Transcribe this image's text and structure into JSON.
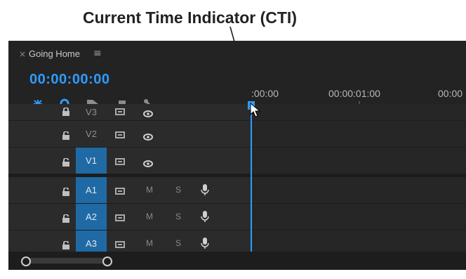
{
  "callout": {
    "label": "Current Time Indicator (CTI)"
  },
  "panel": {
    "close_glyph": "×",
    "sequence_name": "Going Home",
    "menu_glyph": "≡",
    "timecode": "00:00:00:00",
    "accent": "#2f9bff"
  },
  "toolbar": {
    "icons": [
      "insert-nest-icon",
      "snap-magnet-icon",
      "linked-selection-icon",
      "add-marker-icon",
      "timeline-settings-wrench-icon"
    ]
  },
  "ruler": {
    "labels": [
      ":00:00",
      "00:00:01:00",
      "00:00"
    ]
  },
  "tracks": [
    {
      "lock": "lock-icon",
      "target": "V3",
      "type": "video",
      "active": false
    },
    {
      "lock": "lock-icon",
      "target": "V2",
      "type": "video",
      "active": false
    },
    {
      "lock": "lock-icon",
      "target": "V1",
      "type": "video",
      "active": true
    },
    {
      "lock": "lock-icon",
      "target": "A1",
      "type": "audio",
      "active": true,
      "mute": "M",
      "solo": "S"
    },
    {
      "lock": "lock-icon",
      "target": "A2",
      "type": "audio",
      "active": true,
      "mute": "M",
      "solo": "S"
    },
    {
      "lock": "lock-icon",
      "target": "A3",
      "type": "audio",
      "active": true,
      "mute": "M",
      "solo": "S"
    }
  ]
}
